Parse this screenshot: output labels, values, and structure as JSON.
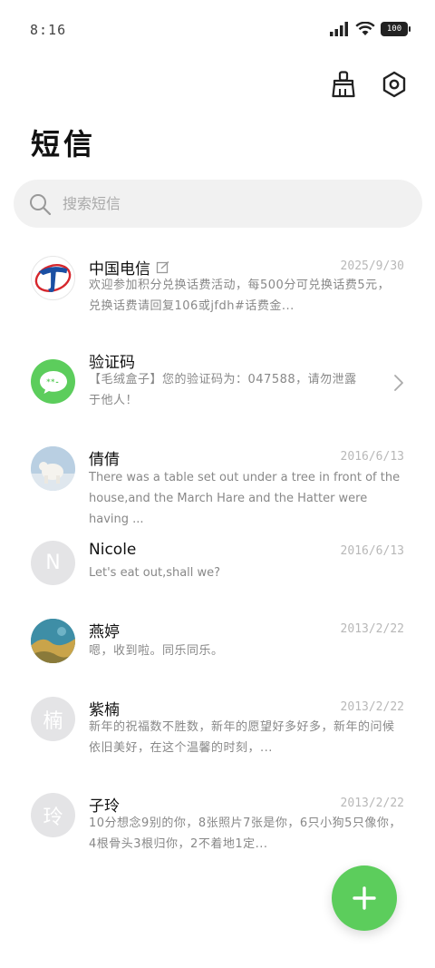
{
  "status_bar": {
    "time": "8:16",
    "battery": "100"
  },
  "header": {
    "title": "短信"
  },
  "search": {
    "placeholder": "搜索短信"
  },
  "messages": [
    {
      "sender": "中国电信",
      "date": "2025/9/30",
      "preview": "欢迎参加积分兑换话费活动，每500分可兑换话费5元，兑换话费请回复106或jfdh#话费金..."
    },
    {
      "sender": "验证码",
      "date": "",
      "preview": "【毛绒盒子】您的验证码为：047588，请勿泄露于他人！"
    },
    {
      "sender": "倩倩",
      "date": "2016/6/13",
      "preview": "There was a table set out under a tree in front of the house,and the March Hare and the Hatter were having ..."
    },
    {
      "sender": "Nicole",
      "date": "2016/6/13",
      "avatar_letter": "N",
      "preview": "Let's eat out,shall we?"
    },
    {
      "sender": "燕婷",
      "date": "2013/2/22",
      "preview": "嗯，收到啦。同乐同乐。"
    },
    {
      "sender": "紫楠",
      "date": "2013/2/22",
      "avatar_letter": "楠",
      "preview": "新年的祝福数不胜数，新年的愿望好多好多，新年的问候依旧美好，在这个温馨的时刻，..."
    },
    {
      "sender": "子玲",
      "date": "2013/2/22",
      "avatar_letter": "玲",
      "preview": "10分想念9别的你，8张照片7张是你，6只小狗5只像你，4根骨头3根归你，2不着地1定..."
    }
  ],
  "colors": {
    "accent": "#5ccd5c",
    "search_bg": "#f1f1f1",
    "date": "#b8b8b8"
  }
}
